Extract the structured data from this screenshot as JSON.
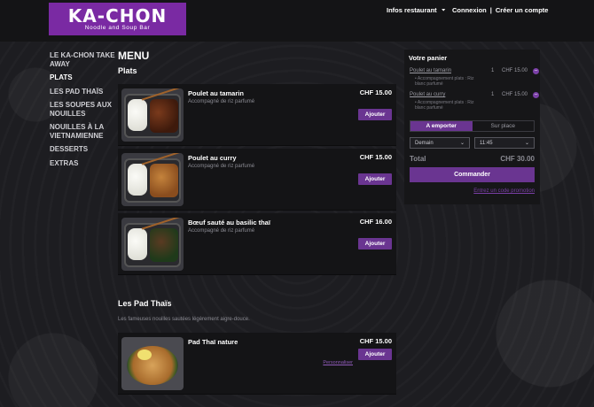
{
  "header": {
    "logo_main": "KA-CHON",
    "logo_sub": "Noodle and Soup Bar",
    "info_label": "Infos restaurant",
    "login_label": "Connexion",
    "separator": "|",
    "register_label": "Créer un compte"
  },
  "sidebar": {
    "items": [
      {
        "label": "Le Ka-chon take away"
      },
      {
        "label": "Plats"
      },
      {
        "label": "Les Pad Thaïs"
      },
      {
        "label": "Les soupes aux nouilles"
      },
      {
        "label": "Nouilles à la vietnamienne"
      },
      {
        "label": "Desserts"
      },
      {
        "label": "Extras"
      }
    ]
  },
  "main": {
    "menu_title": "MENU",
    "section_plats": "Plats",
    "products": [
      {
        "name": "Poulet au tamarin",
        "desc": "Accompagné de riz parfumé",
        "price": "CHF 15.00",
        "add_label": "Ajouter"
      },
      {
        "name": "Poulet au curry",
        "desc": "Accompagné de riz parfumé",
        "price": "CHF 15.00",
        "add_label": "Ajouter"
      },
      {
        "name": "Bœuf sauté au basilic thaï",
        "desc": "Accompagné de riz parfumé",
        "price": "CHF 16.00",
        "add_label": "Ajouter"
      },
      {
        "name": "Pad Thaï nature",
        "desc": "",
        "price": "CHF 15.00",
        "add_label": "Ajouter",
        "custom_label": "Personnaliser"
      }
    ],
    "section_pad": "Les Pad Thaïs",
    "section_pad_sub": "Les fameuses nouilles sautées légèrement aigre-douce."
  },
  "cart": {
    "title": "Votre panier",
    "items": [
      {
        "name": "Poulet au tamarin",
        "qty": "1",
        "price": "CHF 15.00",
        "extra": "• Accompagnement plats : Riz blanc parfumé"
      },
      {
        "name": "Poulet au curry",
        "qty": "1",
        "price": "CHF 15.00",
        "extra": "• Accompagnement plats : Riz blanc parfumé"
      }
    ],
    "mode_takeaway": "A emporter",
    "mode_onsite": "Sur place",
    "day_value": "Demain",
    "time_value": "11:45",
    "total_label": "Total",
    "total_value": "CHF 30.00",
    "order_label": "Commander",
    "promo_label": "Entrez un code promotion"
  },
  "colors": {
    "accent": "#6a3591",
    "logo_bg": "#7a2aa3",
    "background": "#1d1d21"
  }
}
